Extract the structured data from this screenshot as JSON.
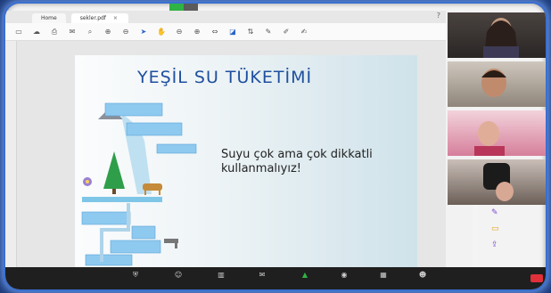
{
  "share_banner": {
    "sharing_text": "",
    "options_label": ""
  },
  "tabs": [
    {
      "label": "Home"
    },
    {
      "label": "sekler.pdf"
    }
  ],
  "slide": {
    "title": "YEŞİL SU TÜKETİMİ",
    "body": "Suyu çok ama çok dikkatli kullanmalıyız!"
  },
  "participants": [
    {
      "name": ""
    },
    {
      "name": ""
    },
    {
      "name": ""
    },
    {
      "name": ""
    }
  ],
  "zoom_controls": [
    {
      "label": "",
      "icon": "security-icon"
    },
    {
      "label": "",
      "icon": "participants-icon"
    },
    {
      "label": "",
      "icon": "polls-icon"
    },
    {
      "label": "",
      "icon": "chat-icon"
    },
    {
      "label": "",
      "icon": "share-screen-icon"
    },
    {
      "label": "",
      "icon": "record-icon"
    },
    {
      "label": "",
      "icon": "breakout-rooms-icon"
    },
    {
      "label": "",
      "icon": "reactions-icon"
    }
  ],
  "colors": {
    "accent": "#2fb344",
    "title_blue": "#1e4f9e",
    "frame_glow": "#3a6fd0",
    "end": "#e0303a"
  }
}
